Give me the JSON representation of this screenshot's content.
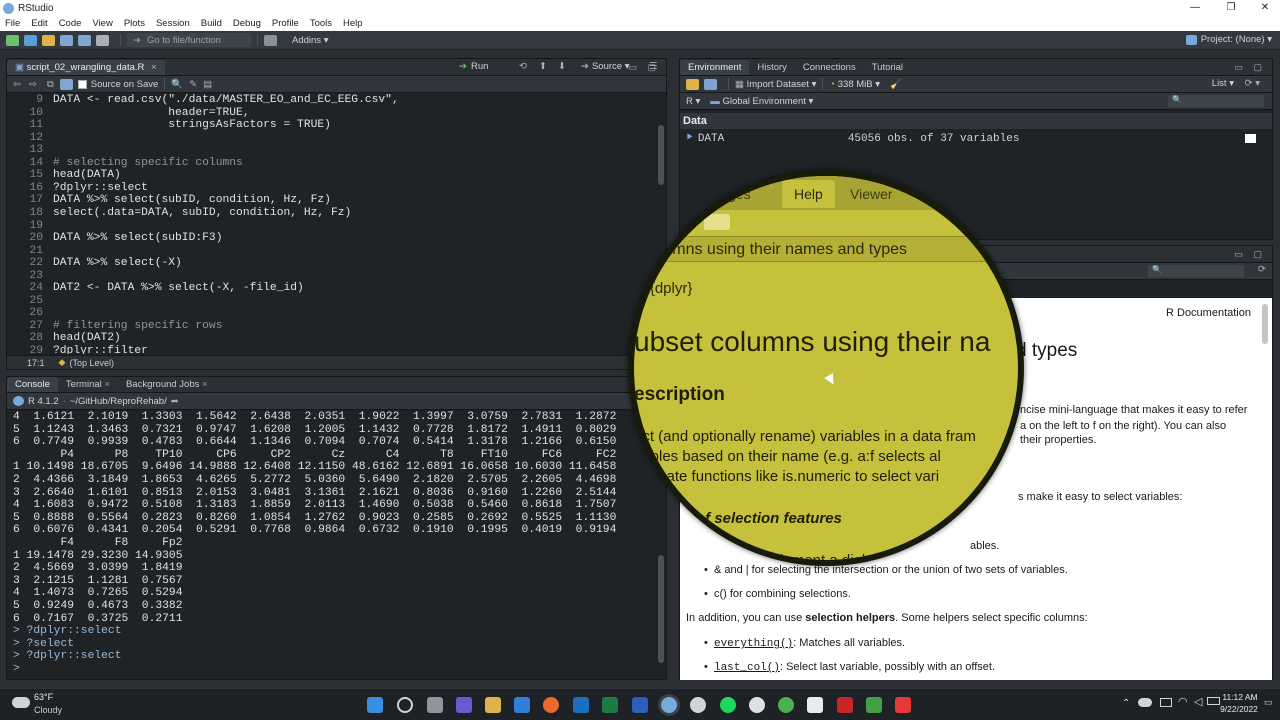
{
  "titlebar": {
    "title": "RStudio"
  },
  "menu": [
    "File",
    "Edit",
    "Code",
    "View",
    "Plots",
    "Session",
    "Build",
    "Debug",
    "Profile",
    "Tools",
    "Help"
  ],
  "toolbar": {
    "goto_placeholder": "Go to file/function",
    "addins": "Addins",
    "project": "Project: (None)"
  },
  "editor": {
    "tab": "script_02_wrangling_data.R",
    "source_on_save": "Source on Save",
    "run": "Run",
    "source": "Source",
    "lines": [
      {
        "n": "9",
        "code": "DATA <- read.csv(\"./data/MASTER_EO_and_EC_EEG.csv\","
      },
      {
        "n": "10",
        "code": "                 header=TRUE,"
      },
      {
        "n": "11",
        "code": "                 stringsAsFactors = TRUE)"
      },
      {
        "n": "12",
        "code": ""
      },
      {
        "n": "13",
        "code": ""
      },
      {
        "n": "14",
        "code": "# selecting specific columns"
      },
      {
        "n": "15",
        "code": "head(DATA)"
      },
      {
        "n": "16",
        "code": "?dplyr::select"
      },
      {
        "n": "17",
        "code": "DATA %>% select(subID, condition, Hz, Fz)"
      },
      {
        "n": "18",
        "code": "select(.data=DATA, subID, condition, Hz, Fz)"
      },
      {
        "n": "19",
        "code": ""
      },
      {
        "n": "20",
        "code": "DATA %>% select(subID:F3)"
      },
      {
        "n": "21",
        "code": ""
      },
      {
        "n": "22",
        "code": "DATA %>% select(-X)"
      },
      {
        "n": "23",
        "code": ""
      },
      {
        "n": "24",
        "code": "DAT2 <- DATA %>% select(-X, -file_id)"
      },
      {
        "n": "25",
        "code": ""
      },
      {
        "n": "26",
        "code": ""
      },
      {
        "n": "27",
        "code": "# filtering specific rows"
      },
      {
        "n": "28",
        "code": "head(DAT2)"
      },
      {
        "n": "29",
        "code": "?dplyr::filter"
      }
    ],
    "status_pos": "17:1",
    "status_scope": "(Top Level)"
  },
  "console": {
    "tabs": [
      "Console",
      "Terminal",
      "Background Jobs"
    ],
    "version": "R 4.1.2",
    "path": "~/GitHub/ReproRehab/",
    "lines": [
      "4  1.6121  2.1019  1.3303  1.5642  2.6438  2.0351  1.9022  1.3997  3.0759  2.7831  1.2872",
      "5  1.1243  1.3463  0.7321  0.9747  1.6208  1.2005  1.1432  0.7728  1.8172  1.4911  0.8029",
      "6  0.7749  0.9939  0.4783  0.6644  1.1346  0.7094  0.7074  0.5414  1.3178  1.2166  0.6150",
      "       P4      P8    TP10     CP6     CP2      Cz      C4      T8    FT10     FC6     FC2",
      "1 10.1498 18.6705  9.6496 14.9888 12.6408 12.1150 48.6162 12.6891 16.0658 10.6030 11.6458",
      "2  4.4366  3.1849  1.8653  4.6265  5.2772  5.0360  5.6490  2.1820  2.5705  2.2605  4.4698",
      "3  2.6640  1.6101  0.8513  2.0153  3.0481  3.1361  2.1621  0.8036  0.9160  1.2260  2.5144",
      "4  1.6083  0.9472  0.5108  1.3183  1.8859  2.0113  1.4690  0.5038  0.5460  0.8618  1.7507",
      "5  0.8888  0.5564  0.2823  0.8260  1.0854  1.2762  0.9023  0.2585  0.2692  0.5525  1.1130",
      "6  0.6076  0.4341  0.2054  0.5291  0.7768  0.9864  0.6732  0.1910  0.1995  0.4019  0.9194",
      "       F4      F8     Fp2",
      "1 19.1478 29.3230 14.9305",
      "2  4.5669  3.0399  1.8419",
      "3  2.1215  1.1281  0.7567",
      "4  1.4073  0.7265  0.5294",
      "5  0.9249  0.4673  0.3382",
      "6  0.7167  0.3725  0.2711",
      "> ?dplyr::select",
      "> ?select",
      "> ?dplyr::select",
      "> "
    ]
  },
  "environment": {
    "tabs": [
      "Environment",
      "History",
      "Connections",
      "Tutorial"
    ],
    "import_dataset": "Import Dataset",
    "memory": "338 MiB",
    "list_view": "List",
    "lang": "R",
    "scope": "Global Environment",
    "section": "Data",
    "rows": [
      {
        "name": "DATA",
        "value": "45056 obs. of 37 variables"
      }
    ]
  },
  "help": {
    "r_documentation": "R Documentation",
    "title_suffix": "d types",
    "desc_line1": "ncise mini-language that makes it easy to refer",
    "desc_line2": "a on the left to f on the right). You can also",
    "desc_line3": "their properties.",
    "features_tail": "s make it easy to select variables:",
    "bullet1_tail": "ables.",
    "bullet2": "& and | for selecting the intersection or the union of two sets of variables.",
    "bullet3": "c() for combining selections.",
    "helpers_intro_a": "In addition, you can use ",
    "helpers_intro_b": "selection helpers",
    "helpers_intro_c": ". Some helpers select specific columns:",
    "helper1_code": "everything()",
    "helper1_text": ": Matches all variables.",
    "helper2_code": "last_col()",
    "helper2_text": ": Select last variable, possibly with an offset."
  },
  "magnifier": {
    "tab1": "ges",
    "tab2": "Help",
    "tab3": "Viewer",
    "heading_bar": "t columns using their names and types",
    "pkg": "ct {dplyr}",
    "big_title": "ubset columns using their na",
    "description": "escription",
    "desc1": "ect (and optionally rename) variables in a data fram",
    "desc2": "riables based on their name (e.g. a:f selects al",
    "desc3": "redicate functions like is.numeric to select vari",
    "overview": "of selection features",
    "implement": "implement a dial"
  },
  "taskbar": {
    "weather_temp": "63°F",
    "weather_desc": "Cloudy",
    "time": "11:12 AM",
    "date": "9/22/2022"
  }
}
